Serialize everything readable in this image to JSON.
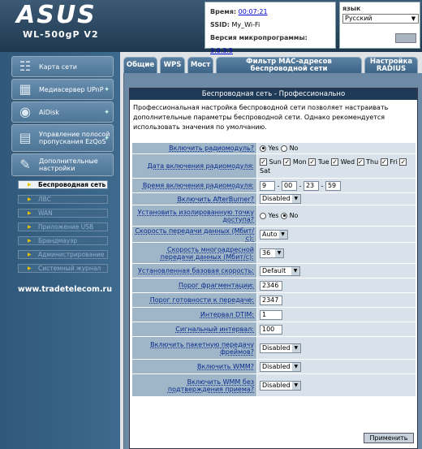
{
  "brand": {
    "logo": "ASUS",
    "model": "WL-500gP V2"
  },
  "info": {
    "time_label": "Время:",
    "time_value": "00:07:21",
    "ssid_label": "SSID:",
    "ssid_value": "My_Wi-Fi",
    "firmware_label": "Версия микропрограммы:",
    "firmware_value": "3.0.3.5"
  },
  "lang": {
    "label": "язык",
    "selected": "Русский"
  },
  "menu": [
    {
      "label": "Карта сети",
      "icon": "network-map-icon"
    },
    {
      "label": "Медиасервер UPnP",
      "icon": "media-server-icon"
    },
    {
      "label": "AiDisk",
      "icon": "aidisk-icon"
    },
    {
      "label": "Управление полосой пропускания EzQoS",
      "icon": "ezqos-icon"
    },
    {
      "label": "Дополнительные настройки",
      "icon": "tools-icon"
    }
  ],
  "submenu": [
    "Беспроводная сеть",
    "ЛВС",
    "WAN",
    "Приложение USB",
    "Брандмауэр",
    "Администрирование",
    "Системный журнал"
  ],
  "site": "www.tradetelecom.ru",
  "tabs": [
    "Общие",
    "WPS",
    "Мост",
    "Фильтр MAC-адресов беспроводной сети",
    "Настройка RADIUS"
  ],
  "panel": {
    "title": "Беспроводная сеть - Профессионально",
    "description": "Профессиональная настройка беспроводной сети позволяет настраивать дополнительные параметры беспроводной сети. Однако рекомендуется использовать значения по умолчанию."
  },
  "form": {
    "radio": {
      "label": "Включить радиомодуль?",
      "yes": "Yes",
      "no": "No"
    },
    "date": {
      "label": "Дата включения радиомодуля:",
      "days": [
        "Sun",
        "Mon",
        "Tue",
        "Wed",
        "Thu",
        "Fri",
        "Sat"
      ]
    },
    "time": {
      "label": "Время включения радиомодуля:",
      "h1": "9",
      "m1": "00",
      "h2": "23",
      "m2": "59",
      "sep": "-"
    },
    "afterburner": {
      "label": "Включить AfterBurner?",
      "value": "Disabled"
    },
    "isolated": {
      "label": "Установить изолированную точку доступа?",
      "yes": "Yes",
      "no": "No"
    },
    "rate": {
      "label": "Скорость передачи данных (Мбит/с):",
      "value": "Auto"
    },
    "mrate": {
      "label": "Скорость многоадресной передачи данных (Мбит/с):",
      "value": "36"
    },
    "basic": {
      "label": "Установленная базовая скорость:",
      "value": "Default"
    },
    "frag": {
      "label": "Порог фрагментации:",
      "value": "2346"
    },
    "rts": {
      "label": "Порог готовности к передаче:",
      "value": "2347"
    },
    "dtim": {
      "label": "Интервал DTIM:",
      "value": "1"
    },
    "beacon": {
      "label": "Сигнальный интервал:",
      "value": "100"
    },
    "burst": {
      "label": "Включить пакетную передачу фреймов?",
      "value": "Disabled"
    },
    "wmm": {
      "label": "Включить WMM?",
      "value": "Disabled"
    },
    "wmmnoack": {
      "label": "Включить WMM без подтверждения приема?",
      "value": "Disabled"
    }
  },
  "apply_label": "Применить"
}
